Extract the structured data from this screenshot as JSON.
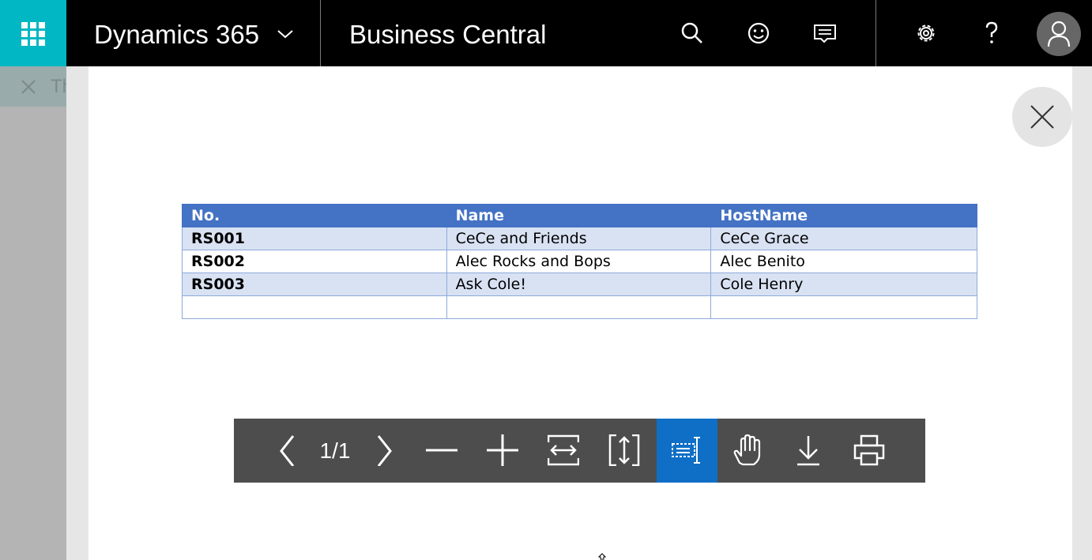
{
  "topbar": {
    "brand": "Dynamics 365",
    "product": "Business Central",
    "icons": [
      "waffle-icon",
      "chevron-down-icon",
      "search-icon",
      "smiley-icon",
      "feedback-icon",
      "gear-icon",
      "help-icon",
      "user-icon"
    ],
    "accent_color": "#00b7c3"
  },
  "background_page": {
    "title_fragment": "Th"
  },
  "report": {
    "headers": [
      "No.",
      "Name",
      "HostName"
    ],
    "rows": [
      [
        "RS001",
        "CeCe and Friends",
        "CeCe Grace"
      ],
      [
        "RS002",
        "Alec Rocks and Bops",
        "Alec Benito"
      ],
      [
        "RS003",
        "Ask Cole!",
        "Cole Henry"
      ],
      [
        "",
        "",
        ""
      ]
    ],
    "header_color": "#4472c4",
    "band_color": "#d9e2f3"
  },
  "pdf_toolbar": {
    "page_indicator": "1/1",
    "tools": [
      "previous-page-icon",
      "next-page-icon",
      "zoom-out-icon",
      "zoom-in-icon",
      "fit-width-icon",
      "fit-page-icon",
      "text-select-icon",
      "pan-hand-icon",
      "download-icon",
      "print-icon"
    ],
    "active_tool": "text-select-icon",
    "active_color": "#0f6fc6"
  }
}
